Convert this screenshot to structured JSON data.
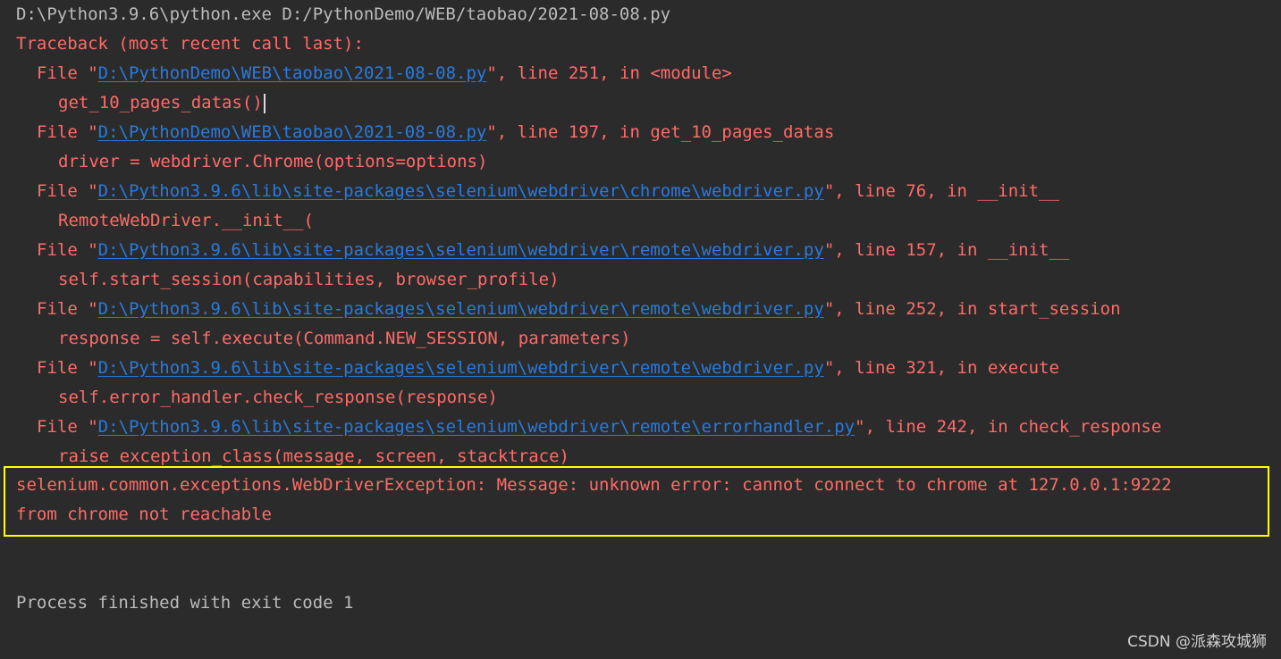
{
  "console": {
    "command": "D:\\Python3.9.6\\python.exe D:/PythonDemo/WEB/taobao/2021-08-08.py",
    "traceback_header": "Traceback (most recent call last):",
    "frames": [
      {
        "file_prefix": "File \"",
        "path": "D:\\PythonDemo\\WEB\\taobao\\2021-08-08.py",
        "suffix": "\", line 251, in <module>",
        "code": "get_10_pages_datas()"
      },
      {
        "file_prefix": "File \"",
        "path": "D:\\PythonDemo\\WEB\\taobao\\2021-08-08.py",
        "suffix": "\", line 197, in get_10_pages_datas",
        "code": "driver = webdriver.Chrome(options=options)"
      },
      {
        "file_prefix": "File \"",
        "path": "D:\\Python3.9.6\\lib\\site-packages\\selenium\\webdriver\\chrome\\webdriver.py",
        "suffix": "\", line 76, in __init__",
        "code": "RemoteWebDriver.__init__("
      },
      {
        "file_prefix": "File \"",
        "path": "D:\\Python3.9.6\\lib\\site-packages\\selenium\\webdriver\\remote\\webdriver.py",
        "suffix": "\", line 157, in __init__",
        "code": "self.start_session(capabilities, browser_profile)"
      },
      {
        "file_prefix": "File \"",
        "path": "D:\\Python3.9.6\\lib\\site-packages\\selenium\\webdriver\\remote\\webdriver.py",
        "suffix": "\", line 252, in start_session",
        "code": "response = self.execute(Command.NEW_SESSION, parameters)"
      },
      {
        "file_prefix": "File \"",
        "path": "D:\\Python3.9.6\\lib\\site-packages\\selenium\\webdriver\\remote\\webdriver.py",
        "suffix": "\", line 321, in execute",
        "code": "self.error_handler.check_response(response)"
      },
      {
        "file_prefix": "File \"",
        "path": "D:\\Python3.9.6\\lib\\site-packages\\selenium\\webdriver\\remote\\errorhandler.py",
        "suffix": "\", line 242, in check_response",
        "code": "raise exception_class(message, screen, stacktrace)"
      }
    ],
    "exception_line1": "selenium.common.exceptions.WebDriverException: Message: unknown error: cannot connect to chrome at 127.0.0.1:9222",
    "exception_line2": "from chrome not reachable",
    "exit_message": "Process finished with exit code 1"
  },
  "watermark": "CSDN @派森攻城狮",
  "colors": {
    "background": "#2b2b2b",
    "normal_text": "#bbbbbb",
    "error_text": "#ff6b68",
    "link": "#287bde",
    "highlight_border": "#ffff00"
  }
}
